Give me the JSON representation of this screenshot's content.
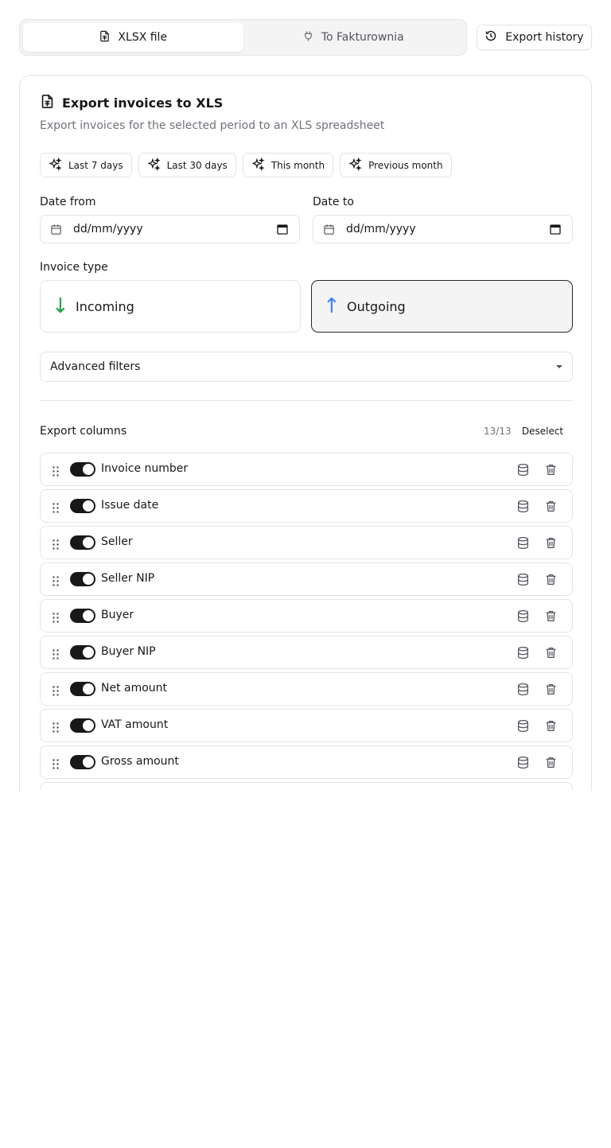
{
  "tabs": [
    {
      "label": "XLSX file",
      "icon": "spreadsheet-file-icon",
      "active": true
    },
    {
      "label": "To Fakturownia",
      "icon": "plug-icon",
      "active": false
    }
  ],
  "header": {
    "history_label": "Export history",
    "history_icon": "history-icon"
  },
  "card": {
    "title": "Export invoices to XLS",
    "subtitle": "Export invoices for the selected period to an XLS spreadsheet"
  },
  "presets": [
    "Last 7 days",
    "Last 30 days",
    "This month",
    "Previous month"
  ],
  "dates": {
    "from_label": "Date from",
    "from_placeholder": "dd/mm/yyyy",
    "to_label": "Date to",
    "to_placeholder": "dd/mm/yyyy"
  },
  "invoice_type": {
    "label": "Invoice type",
    "options": [
      {
        "label": "Incoming",
        "arrow": "↓",
        "color": "#22a34a",
        "selected": false
      },
      {
        "label": "Outgoing",
        "arrow": "↑",
        "color": "#3b82f6",
        "selected": true
      }
    ]
  },
  "filters": {
    "label": "Advanced filters"
  },
  "columns": {
    "header": "Export columns",
    "count": "13/13",
    "deselect_label": "Deselect",
    "items": [
      {
        "label": "Invoice number",
        "enabled": true
      },
      {
        "label": "Issue date",
        "enabled": true
      },
      {
        "label": "Seller",
        "enabled": true
      },
      {
        "label": "Seller NIP",
        "enabled": true
      },
      {
        "label": "Buyer",
        "enabled": true
      },
      {
        "label": "Buyer NIP",
        "enabled": true
      },
      {
        "label": "Net amount",
        "enabled": true
      },
      {
        "label": "VAT amount",
        "enabled": true
      },
      {
        "label": "Gross amount",
        "enabled": true
      }
    ]
  },
  "colors": {
    "accent": "#18181b",
    "border": "#e4e4e7",
    "muted": "#71717a"
  }
}
